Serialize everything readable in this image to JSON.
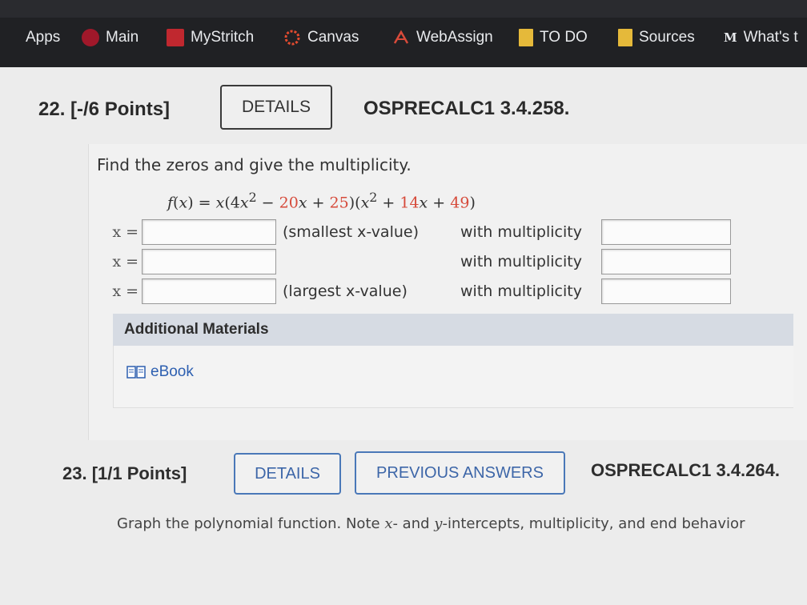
{
  "bookmarks": [
    {
      "label": "Apps",
      "icon": "apps-grid-icon"
    },
    {
      "label": "Main",
      "icon": "main-circle-icon",
      "color": "#a0182a"
    },
    {
      "label": "MyStritch",
      "icon": "mystritch-square-icon",
      "color": "#c0282f"
    },
    {
      "label": "Canvas",
      "icon": "canvas-ring-icon",
      "color": "#e34b2f"
    },
    {
      "label": "WebAssign",
      "icon": "webassign-icon",
      "color": "#d84a3a"
    },
    {
      "label": "TO DO",
      "icon": "folder-icon",
      "color": "#e5b93a"
    },
    {
      "label": "Sources",
      "icon": "folder-icon",
      "color": "#e5b93a"
    },
    {
      "label": "What's t",
      "icon": "medium-m-icon"
    }
  ],
  "q22": {
    "number": "22. [-/6 Points]",
    "details_label": "DETAILS",
    "code": "OSPRECALC1 3.4.258.",
    "prompt": "Find the zeros and give the multiplicity.",
    "rows": [
      {
        "x_label": "x =",
        "note": "(smallest x-value)",
        "mult_label": "with multiplicity",
        "x_value": "",
        "mult_value": ""
      },
      {
        "x_label": "x =",
        "note": "",
        "mult_label": "with multiplicity",
        "x_value": "",
        "mult_value": ""
      },
      {
        "x_label": "x =",
        "note": "(largest x-value)",
        "mult_label": "with multiplicity",
        "x_value": "",
        "mult_value": ""
      }
    ],
    "additional_materials": "Additional Materials",
    "ebook": "eBook"
  },
  "q23": {
    "number": "23. [1/1 Points]",
    "details_label": "DETAILS",
    "previous_answers_label": "PREVIOUS ANSWERS",
    "code": "OSPRECALC1 3.4.264.",
    "text_prefix": "Graph the polynomial function. Note ",
    "text_x": "x",
    "text_mid": "- and ",
    "text_y": "y",
    "text_suffix": "-intercepts, multiplicity, and end behavior"
  }
}
